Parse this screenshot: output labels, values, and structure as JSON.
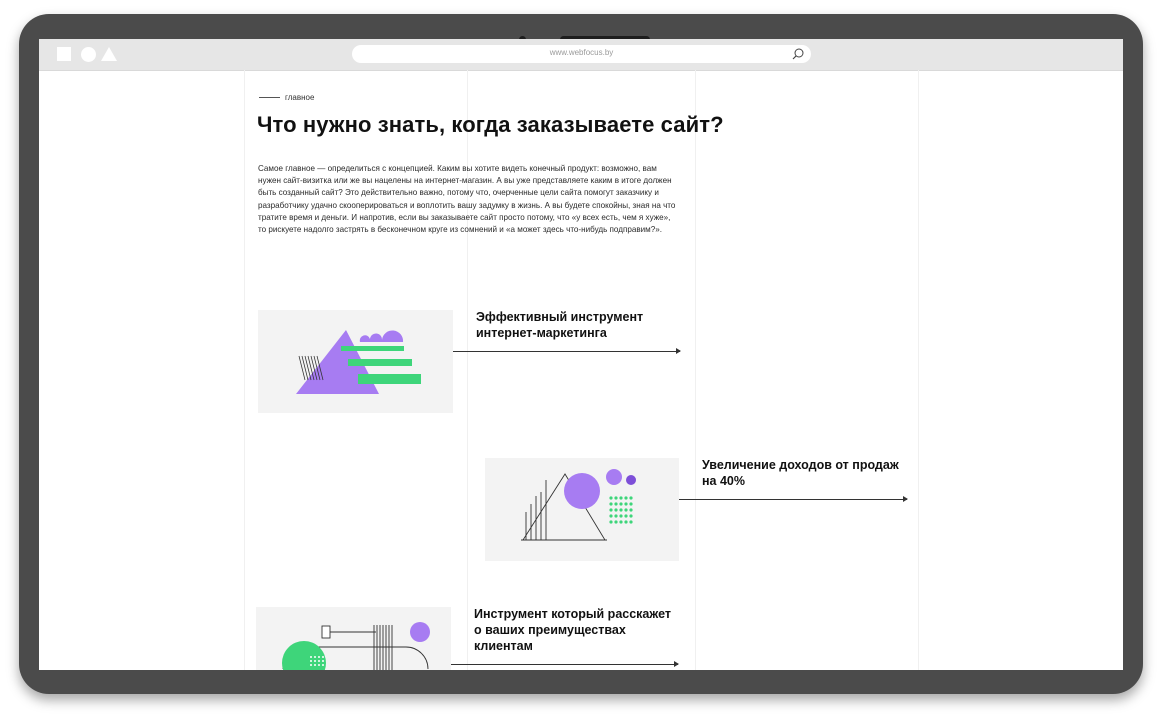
{
  "browser": {
    "url": "www.webfocus.by"
  },
  "page": {
    "breadcrumb": "главное",
    "title": "Что нужно знать, когда заказываете сайт?",
    "intro": "Самое главное — определиться с концепцией. Каким вы хотите видеть конечный продукт: возможно, вам нужен сайт-визитка или же вы нацелены на интернет-магазин. А вы уже представляете каким в итоге должен быть созданный сайт? Это действительно важно, потому что, очерченные цели сайта помогут заказчику и разработчику удачно скооперироваться и воплотить вашу задумку в жизнь. А вы будете спокойны, зная на что тратите время и деньги. И напротив, если вы заказываете сайт просто потому, что «у всех есть, чем я хуже», то рискуете надолго застрять в бесконечном круге из сомнений и «а может здесь что-нибудь подправим?».",
    "features": [
      {
        "title": "Эффективный инструмент интернет-маркетинга"
      },
      {
        "title": "Увеличение доходов от продаж на 40%"
      },
      {
        "title": "Инструмент который расскажет о ваших преимуществах клиентам"
      }
    ]
  },
  "colors": {
    "accent_purple": "#a77cf2",
    "accent_green": "#3ed57a",
    "card_bg": "#f3f3f3",
    "device_frame": "#4b4b4b"
  }
}
